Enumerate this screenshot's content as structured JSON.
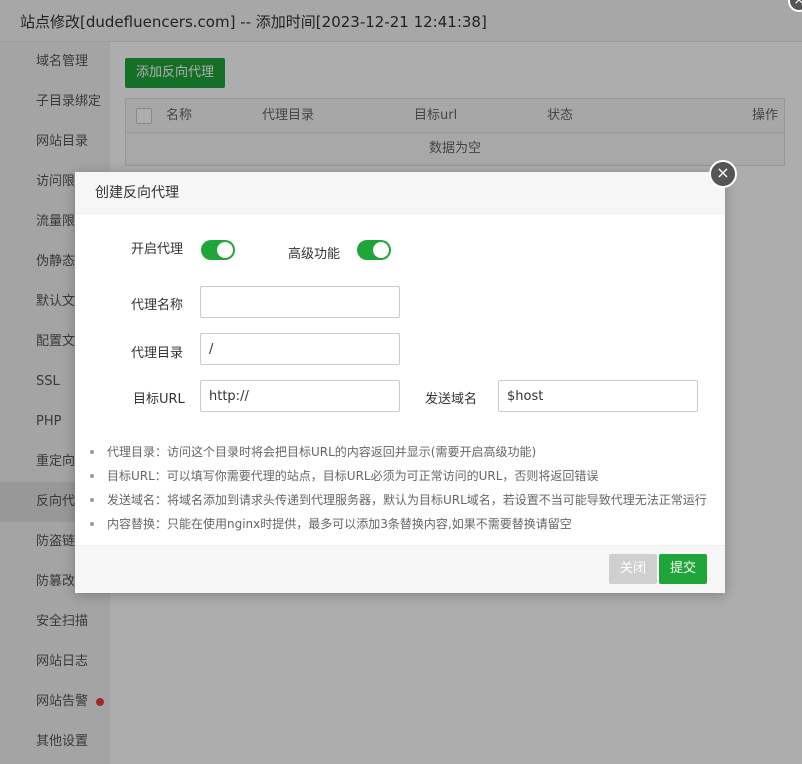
{
  "window": {
    "title": "站点修改[dudefluencers.com] -- 添加时间[2023-12-21 12:41:38]",
    "close_icon": "×"
  },
  "sidebar": {
    "items": [
      {
        "label": "域名管理"
      },
      {
        "label": "子目录绑定"
      },
      {
        "label": "网站目录"
      },
      {
        "label": "访问限制"
      },
      {
        "label": "流量限制"
      },
      {
        "label": "伪静态"
      },
      {
        "label": "默认文档"
      },
      {
        "label": "配置文件"
      },
      {
        "label": "SSL"
      },
      {
        "label": "PHP"
      },
      {
        "label": "重定向"
      },
      {
        "label": "反向代理"
      },
      {
        "label": "防盗链"
      },
      {
        "label": "防篡改"
      },
      {
        "label": "安全扫描"
      },
      {
        "label": "网站日志"
      },
      {
        "label": "网站告警"
      },
      {
        "label": "其他设置"
      }
    ],
    "active_index": 11,
    "alert_dot_color": "#ef3b3b"
  },
  "main": {
    "add_button": "添加反向代理",
    "table": {
      "headers": [
        "名称",
        "代理目录",
        "目标url",
        "状态",
        "操作"
      ],
      "empty_text": "数据为空"
    }
  },
  "modal": {
    "title": "创建反向代理",
    "close_icon": "×",
    "toggles": {
      "proxy_label": "开启代理",
      "proxy_on": true,
      "advanced_label": "高级功能",
      "advanced_on": true
    },
    "fields": {
      "name_label": "代理名称",
      "name_value": "",
      "dir_label": "代理目录",
      "dir_value": "/",
      "url_label": "目标URL",
      "url_value": "http://",
      "domain_label": "发送域名",
      "domain_value": "$host"
    },
    "tips": [
      "代理目录：访问这个目录时将会把目标URL的内容返回并显示(需要开启高级功能)",
      "目标URL：可以填写你需要代理的站点，目标URL必须为可正常访问的URL，否则将返回错误",
      "发送域名：将域名添加到请求头传递到代理服务器，默认为目标URL域名，若设置不当可能导致代理无法正常运行",
      "内容替换：只能在使用nginx时提供，最多可以添加3条替换内容,如果不需要替换请留空"
    ],
    "buttons": {
      "close": "关闭",
      "submit": "提交"
    }
  },
  "colors": {
    "accent": "#20a53a",
    "disabled": "#cfcfcf"
  }
}
